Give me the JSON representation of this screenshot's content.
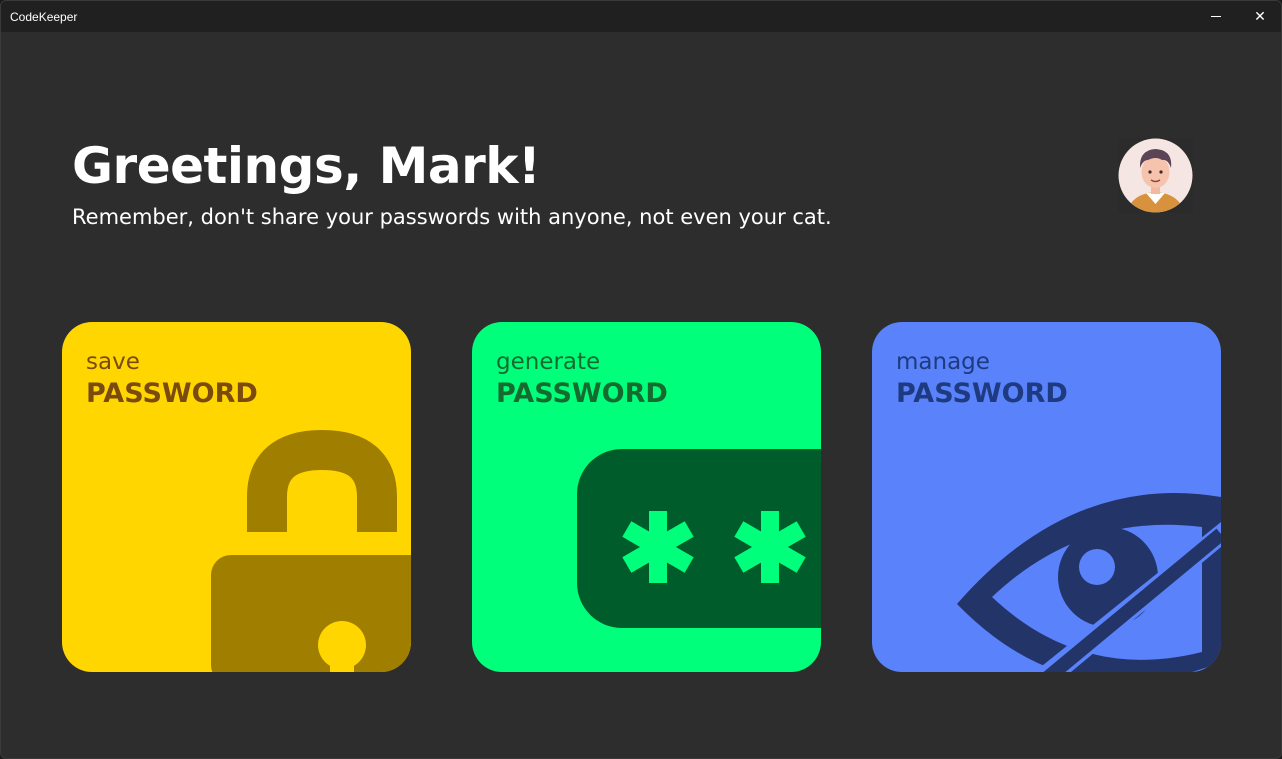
{
  "window": {
    "title": "CodeKeeper",
    "close_glyph": "✕"
  },
  "header": {
    "greeting": "Greetings, Mark!",
    "subtitle": "Remember, don't share your passwords with anyone, not even your cat."
  },
  "cards": [
    {
      "id": "save",
      "top": "save",
      "bottom": "PASSWORD",
      "icon": "padlock-icon",
      "color": "#ffd600"
    },
    {
      "id": "generate",
      "top": "generate",
      "bottom": "PASSWORD",
      "icon": "asterisk-password-icon",
      "color": "#00ff7b"
    },
    {
      "id": "manage",
      "top": "manage",
      "bottom": "PASSWORD",
      "icon": "eye-slash-icon",
      "color": "#5a82fa"
    }
  ],
  "colors": {
    "background": "#2d2d2d",
    "titlebar": "#202020",
    "save_accent": "#a07f00",
    "generate_accent": "#005c2b",
    "manage_accent": "#233469"
  }
}
